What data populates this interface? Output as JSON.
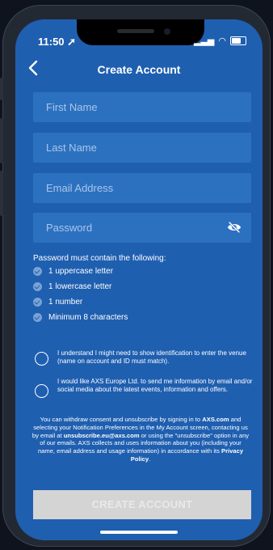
{
  "status": {
    "time": "11:50"
  },
  "header": {
    "title": "Create Account"
  },
  "form": {
    "first_name_placeholder": "First Name",
    "last_name_placeholder": "Last Name",
    "email_placeholder": "Email Address",
    "password_placeholder": "Password"
  },
  "password_rules": {
    "heading": "Password must contain the following:",
    "items": [
      "1 uppercase letter",
      "1 lowercase letter",
      "1 number",
      "Minimum 8 characters"
    ]
  },
  "consents": [
    "I understand I might need to show identification to enter the venue (name on account and ID must match).",
    "I would like AXS Europe Ltd. to send me information by email and/or social media about the latest events, information and offers."
  ],
  "footer": {
    "p1": "You can withdraw consent and unsubscribe by signing in to ",
    "b1": "AXS.com",
    "p2": " and selecting your Notification Preferences in the My Account screen, contacting us by email at ",
    "b2": "unsubscribe.eu@axs.com",
    "p3": " or using the \"unsubscribe\" option in any of our emails. AXS collects and uses information about you (including your name, email address and usage information) in accordance with its ",
    "b3": "Privacy Policy",
    "p4": "."
  },
  "actions": {
    "create_account": "CREATE ACCOUNT"
  },
  "colors": {
    "background": "#1f5fb0",
    "field": "#2c71c0",
    "button_disabled": "#d4d4d4"
  }
}
